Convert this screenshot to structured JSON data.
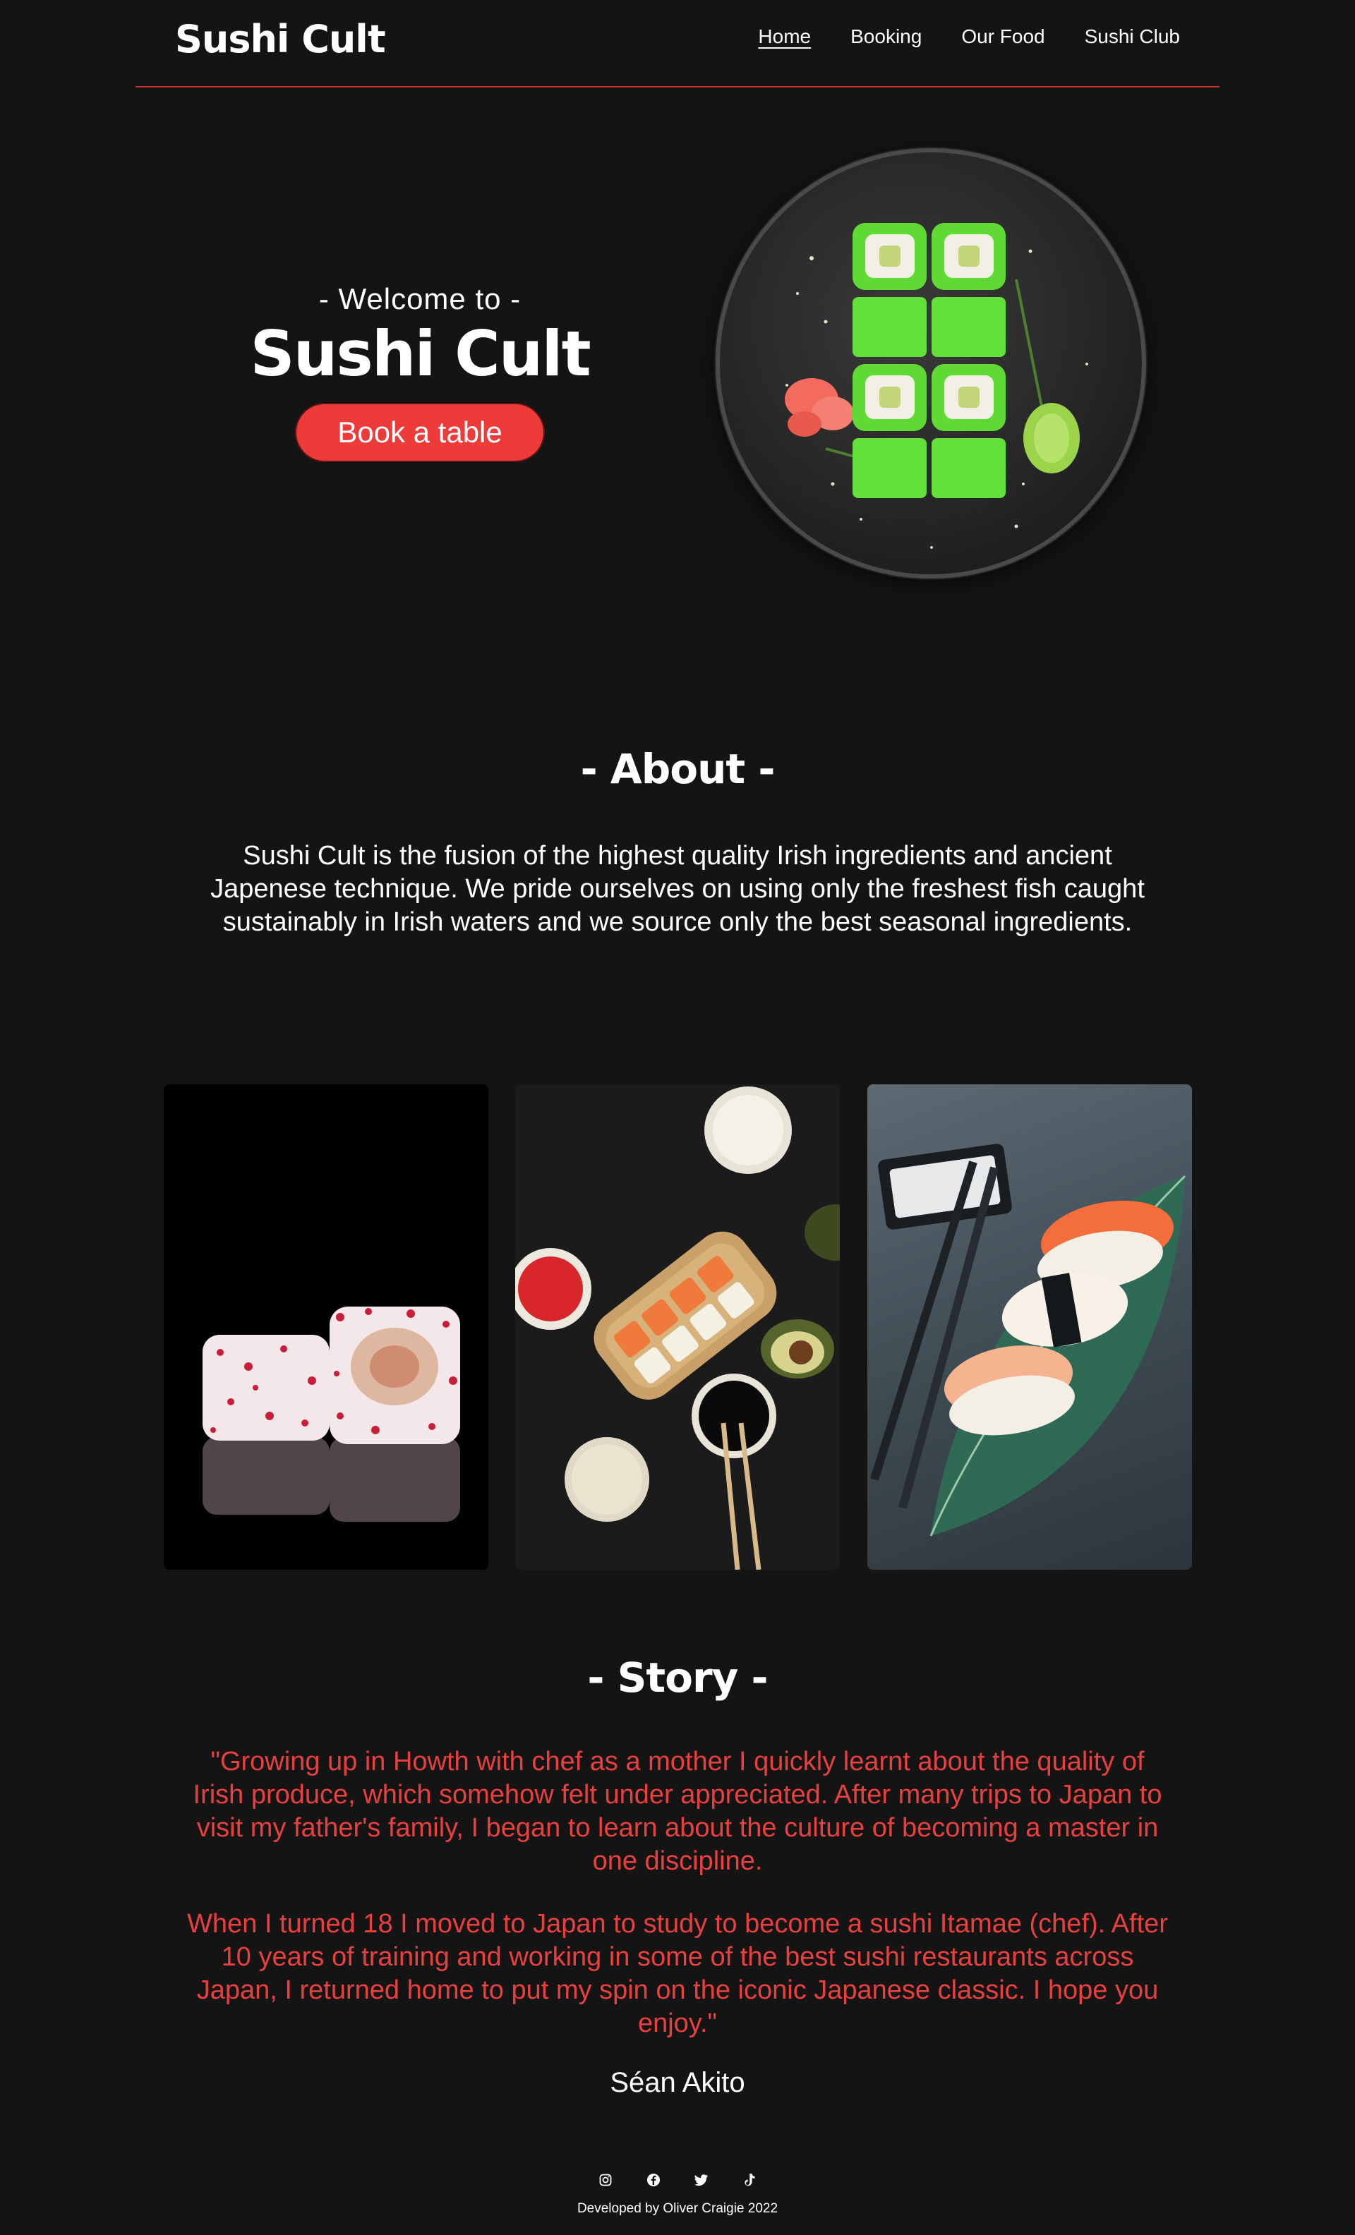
{
  "header": {
    "brand": "Sushi Cult",
    "nav": [
      {
        "label": "Home",
        "active": true
      },
      {
        "label": "Booking",
        "active": false
      },
      {
        "label": "Our Food",
        "active": false
      },
      {
        "label": "Sushi Club",
        "active": false
      }
    ]
  },
  "hero": {
    "welcome": "- Welcome to -",
    "title": "Sushi Cult",
    "cta": "Book a table"
  },
  "about": {
    "title": "- About -",
    "text": "Sushi Cult is the fusion of the highest quality Irish ingredients and ancient Japenese technique. We pride ourselves on using only the freshest fish caught sustainably in Irish waters and we source only the best seasonal ingredients."
  },
  "story": {
    "title": "- Story -",
    "p1": "\"Growing up in Howth with chef as a mother I quickly learnt about the quality of Irish produce, which somehow felt under appreciated. After many trips to Japan to visit my father's family, I began to learn about the culture of becoming a master in one discipline.",
    "p2": "When I turned 18 I moved to Japan to study to become a sushi Itamae (chef). After 10 years of training and working in some of the best sushi restaurants across Japan, I returned home to put my spin on the iconic Japanese classic. I hope you enjoy.\"",
    "author": "Séan Akito"
  },
  "footer": {
    "socials": [
      "instagram-icon",
      "facebook-icon",
      "twitter-icon",
      "tiktok-icon"
    ],
    "credit": "Developed by Oliver Craigie 2022"
  },
  "colors": {
    "background": "#141414",
    "accent": "#ee3a39",
    "story_text": "#e8403f",
    "roll_green": "#5fd934"
  }
}
